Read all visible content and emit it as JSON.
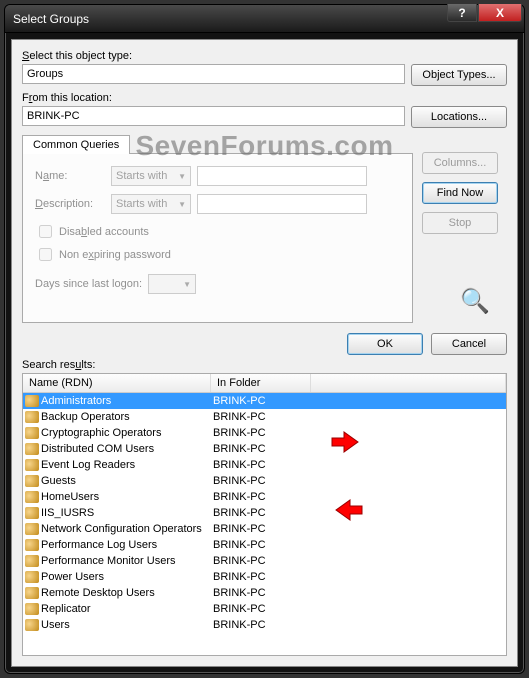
{
  "window": {
    "title": "Select Groups",
    "help": "?",
    "close": "X"
  },
  "objectType": {
    "label": "Select this object type:",
    "value": "Groups",
    "button": "Object Types..."
  },
  "location": {
    "label_pre": "F",
    "label_u": "r",
    "label_post": "om this location:",
    "value": "BRINK-PC",
    "button": "Locations..."
  },
  "queries": {
    "tab": "Common Queries",
    "name": {
      "label_pre": "N",
      "label_u": "a",
      "label_post": "me:",
      "mode": "Starts with"
    },
    "desc": {
      "label_pre": "",
      "label_u": "D",
      "label_post": "escription:",
      "mode": "Starts with"
    },
    "disabled": {
      "label_pre": "Disa",
      "label_u": "b",
      "label_post": "led accounts"
    },
    "nonexpiring": {
      "label_pre": "Non e",
      "label_u": "x",
      "label_post": "piring password"
    },
    "days": {
      "label_pre": "Days since last logon:",
      "label_u": "",
      "label_post": ""
    },
    "columns": "Columns...",
    "findnow": "Find Now",
    "stop": "Stop"
  },
  "actions": {
    "ok": "OK",
    "cancel": "Cancel"
  },
  "results": {
    "label_pre": "Search res",
    "label_u": "u",
    "label_post": "lts:",
    "col_name": "Name (RDN)",
    "col_folder": "In Folder",
    "rows": [
      {
        "name": "Administrators",
        "folder": "BRINK-PC",
        "selected": true
      },
      {
        "name": "Backup Operators",
        "folder": "BRINK-PC"
      },
      {
        "name": "Cryptographic Operators",
        "folder": "BRINK-PC"
      },
      {
        "name": "Distributed COM Users",
        "folder": "BRINK-PC"
      },
      {
        "name": "Event Log Readers",
        "folder": "BRINK-PC"
      },
      {
        "name": "Guests",
        "folder": "BRINK-PC"
      },
      {
        "name": "HomeUsers",
        "folder": "BRINK-PC"
      },
      {
        "name": "IIS_IUSRS",
        "folder": "BRINK-PC"
      },
      {
        "name": "Network Configuration Operators",
        "folder": "BRINK-PC"
      },
      {
        "name": "Performance Log Users",
        "folder": "BRINK-PC"
      },
      {
        "name": "Performance Monitor Users",
        "folder": "BRINK-PC"
      },
      {
        "name": "Power Users",
        "folder": "BRINK-PC"
      },
      {
        "name": "Remote Desktop Users",
        "folder": "BRINK-PC"
      },
      {
        "name": "Replicator",
        "folder": "BRINK-PC"
      },
      {
        "name": "Users",
        "folder": "BRINK-PC"
      }
    ]
  },
  "watermark": "SevenForums.com"
}
